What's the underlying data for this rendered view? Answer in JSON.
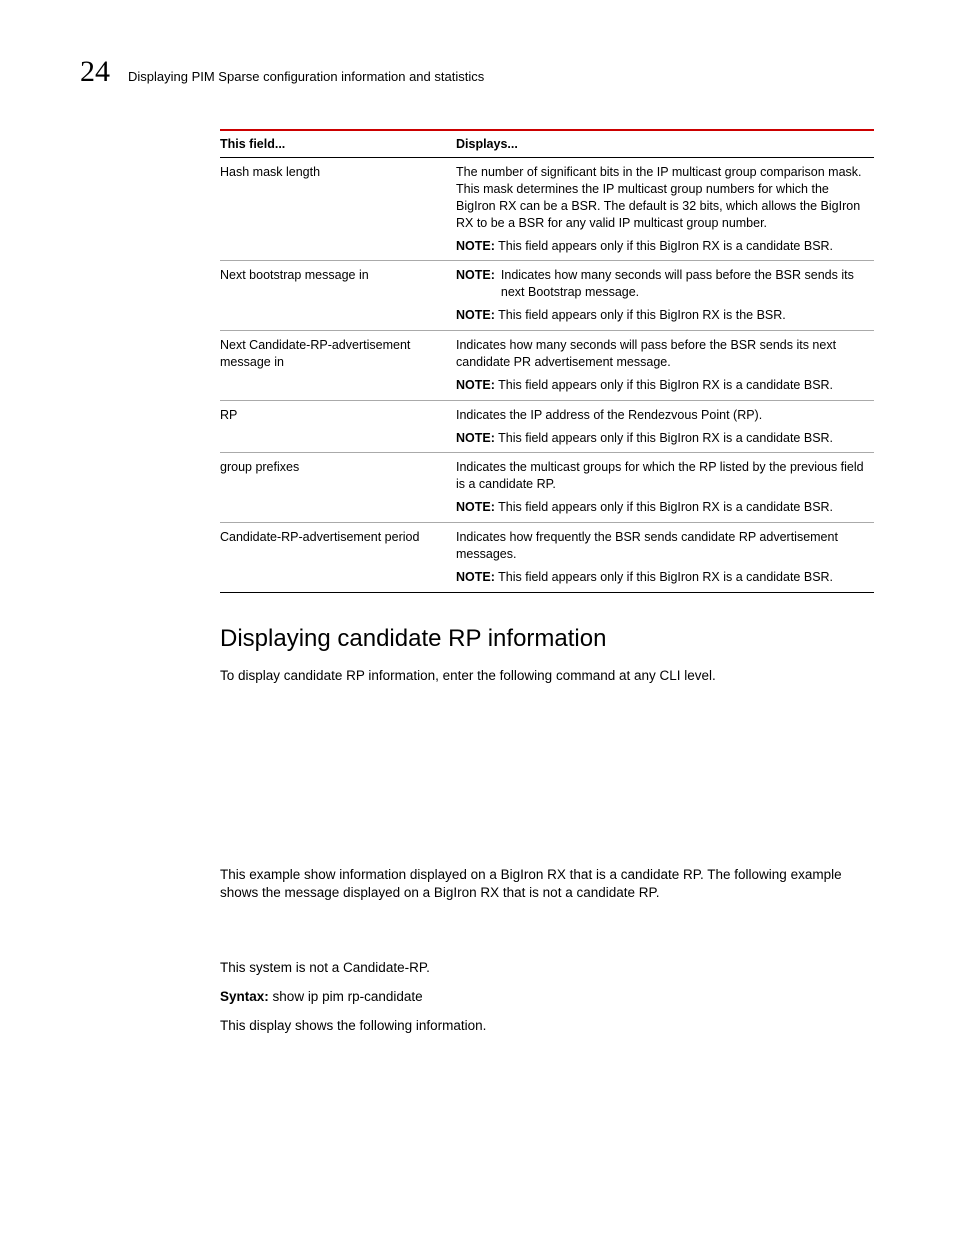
{
  "header": {
    "chapter": "24",
    "title": "Displaying PIM Sparse configuration information and statistics"
  },
  "table": {
    "head_field": "This field...",
    "head_displays": "Displays...",
    "rows": [
      {
        "field": "Hash mask length",
        "desc": "The number of significant bits in the IP multicast group comparison mask. This mask determines the IP multicast group numbers for which the BigIron RX can be a BSR. The default is 32 bits, which allows the BigIron RX to be a BSR for any valid IP multicast group number.",
        "note_inline": "This field appears only if this BigIron RX is a candidate BSR."
      },
      {
        "field": "Next bootstrap message in",
        "desc_note_first": "Indicates how many seconds will pass before the BSR sends its next Bootstrap message.",
        "note_inline": "This field appears only if this BigIron RX is the BSR."
      },
      {
        "field": "Next Candidate-RP-advertisement message in",
        "desc": "Indicates how many seconds will pass before the BSR sends its next candidate PR advertisement message.",
        "note_inline": "This field appears only if this BigIron RX is a candidate BSR."
      },
      {
        "field": "RP",
        "desc": "Indicates the IP address of the Rendezvous Point (RP).",
        "note_inline": "This field appears only if this BigIron RX is a candidate BSR."
      },
      {
        "field": "group prefixes",
        "desc": "Indicates the multicast groups for which the RP listed by the previous field is a candidate RP.",
        "note_inline": "This field appears only if this BigIron RX is a candidate BSR."
      },
      {
        "field": "Candidate-RP-advertisement period",
        "desc": "Indicates how frequently the BSR sends candidate RP advertisement messages.",
        "note_inline": "This field appears only if this BigIron RX is a candidate BSR."
      }
    ],
    "note_label": "NOTE:"
  },
  "section": {
    "title": "Displaying candidate RP information",
    "intro": "To display candidate RP information, enter the following command at any CLI level.",
    "para2": "This example show information displayed on a BigIron RX that is a candidate RP. The following example shows the message displayed on a BigIron RX that is not a candidate RP.",
    "para3": "This system is not a Candidate-RP.",
    "syntax_label": "Syntax:",
    "syntax_cmd": "show ip pim rp-candidate",
    "para4": "This display shows the following information."
  }
}
